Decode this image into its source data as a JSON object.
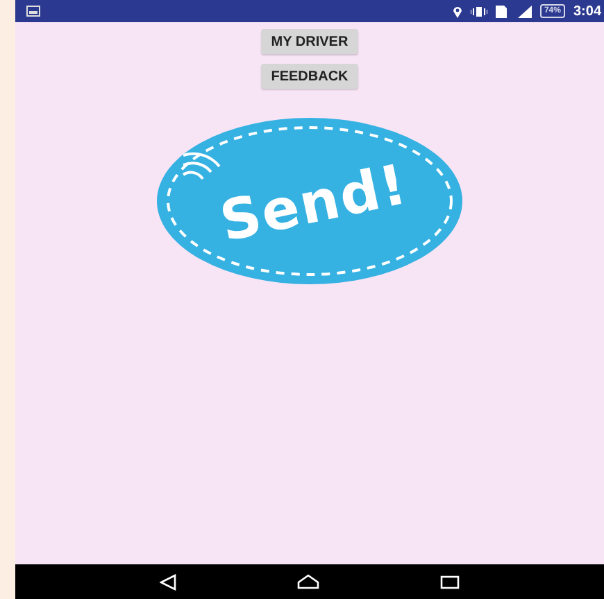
{
  "status_bar": {
    "battery": "74%",
    "time": "3:04"
  },
  "buttons": [
    {
      "label": "MY DRIVER"
    },
    {
      "label": "FEEDBACK"
    }
  ],
  "logo": {
    "text": "Send!"
  }
}
